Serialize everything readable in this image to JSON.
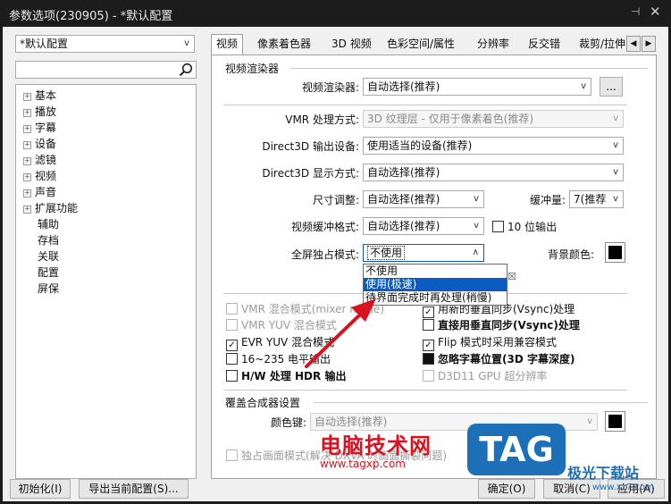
{
  "window": {
    "title": "参数选项(230905) - *默认配置",
    "pin": "⊣",
    "close": "✕"
  },
  "left": {
    "profile_combo": "*默认配置",
    "search_placeholder": "",
    "tree": [
      {
        "label": "基本",
        "expandable": true
      },
      {
        "label": "播放",
        "expandable": true
      },
      {
        "label": "字幕",
        "expandable": true
      },
      {
        "label": "设备",
        "expandable": true
      },
      {
        "label": "滤镜",
        "expandable": true
      },
      {
        "label": "视频",
        "expandable": true
      },
      {
        "label": "声音",
        "expandable": true
      },
      {
        "label": "扩展功能",
        "expandable": true
      },
      {
        "label": "辅助",
        "expandable": false
      },
      {
        "label": "存档",
        "expandable": false
      },
      {
        "label": "关联",
        "expandable": false
      },
      {
        "label": "配置",
        "expandable": false
      },
      {
        "label": "屏保",
        "expandable": false
      }
    ]
  },
  "tabs": [
    "视频",
    "像素着色器",
    "3D 视频",
    "色彩空间/属性",
    "分辨率",
    "反交错",
    "裁剪/拉伸"
  ],
  "renderer_group": {
    "title": "视频渲染器",
    "renderer_label": "视频渲染器:",
    "renderer_value": "自动选择(推荐)",
    "more_button": "...",
    "vmr_label": "VMR 处理方式:",
    "vmr_value": "3D 纹理层 - 仅用于像素着色(推荐)",
    "d3d_out_label": "Direct3D 输出设备:",
    "d3d_out_value": "使用适当的设备(推荐)",
    "d3d_disp_label": "Direct3D 显示方式:",
    "d3d_disp_value": "自动选择(推荐)",
    "resize_label": "尺寸调整:",
    "resize_value": "自动选择(推荐)",
    "buffer_label": "缓冲量:",
    "buffer_value": "7(推荐",
    "buffer_format_label": "视频缓冲格式:",
    "buffer_format_value": "自动选择(推荐)",
    "ten_bit_label": "10 位输出",
    "fullscreen_label": "全屏独占模式:",
    "fullscreen_value": "不使用",
    "bgcolor_label": "背景颜色:",
    "bgcolor": "#000000",
    "dropdown_options": [
      "不使用",
      "使用(极速)",
      "待界面完成时再处理(稍慢)"
    ],
    "dropdown_selected_index": 1
  },
  "checkboxes_left": [
    {
      "label": "VMR 混合模式(mixer mode)",
      "checked": false,
      "disabled": true
    },
    {
      "label": "VMR YUV 混合模式",
      "checked": false,
      "disabled": true
    },
    {
      "label": "EVR YUV 混合模式",
      "checked": true,
      "disabled": false
    },
    {
      "label": "16~235 电平输出",
      "checked": false,
      "disabled": false
    },
    {
      "label": "H/W 处理 HDR 输出",
      "checked": false,
      "disabled": false,
      "bold": true
    }
  ],
  "checkboxes_right": [
    {
      "label": "用新的垂直同步(Vsync)处理",
      "checked": true,
      "disabled": false
    },
    {
      "label": "直接用垂直同步(Vsync)处理",
      "checked": false,
      "disabled": false,
      "bold": true
    },
    {
      "label": "Flip 模式时采用兼容模式",
      "checked": true,
      "disabled": false
    },
    {
      "label": "忽略字幕位置(3D 字幕深度)",
      "checked": true,
      "disabled": false,
      "bold": true,
      "filled": true
    },
    {
      "label": "D3D11 GPU 超分辨率",
      "checked": false,
      "disabled": true
    }
  ],
  "overlay_group": {
    "title": "覆盖合成器设置",
    "colorkey_label": "颜色键:",
    "colorkey_value": "自动选择(推荐)",
    "colorkey_swatch": "#000000",
    "exclusive_label": "独占画面模式(解决 DXVA 时画面撕裂问题)"
  },
  "bottom": {
    "init_button": "初始化(I)",
    "export_button": "导出当前配置(S)...",
    "ok_button": "确定(O)",
    "cancel_button": "取消(C)",
    "apply_button": "应用(A)"
  },
  "watermark": {
    "site_name": "电脑技术网",
    "site_url": "www.tagxp.com",
    "tag": "TAG",
    "brand": "极光下载站",
    "brand_url": "www.xz7.com"
  }
}
